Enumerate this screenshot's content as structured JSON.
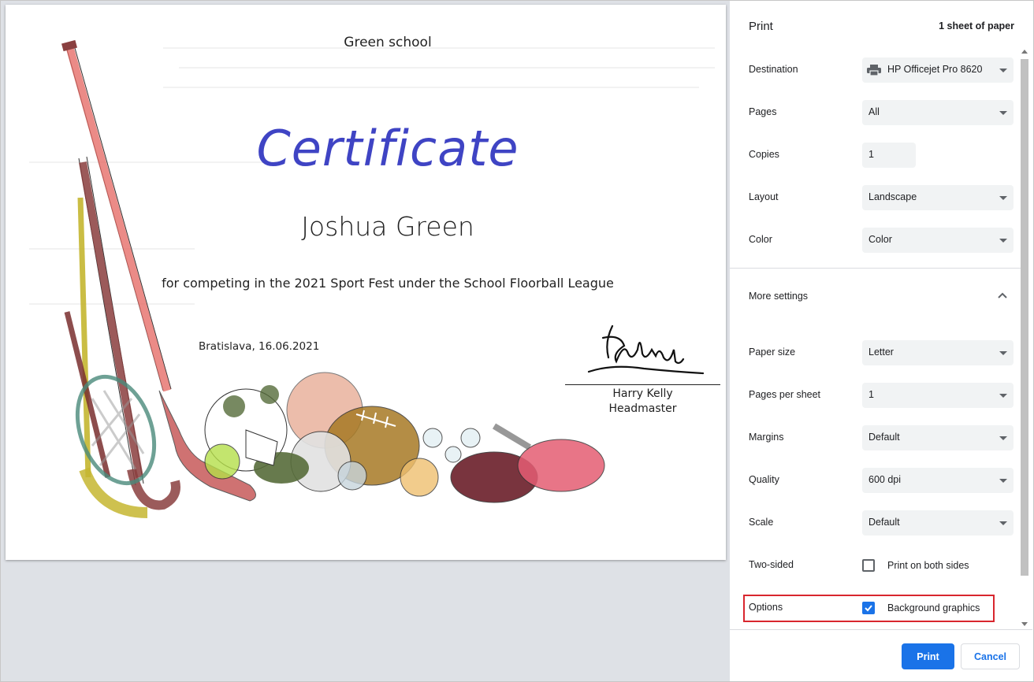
{
  "certificate": {
    "school": "Green school",
    "title": "Certificate",
    "name": "Joshua Green",
    "reason": "for competing in the 2021 Sport Fest under the School Floorball League",
    "place_date": "Bratislava, 16.06.2021",
    "signer_name": "Harry Kelly",
    "signer_role": "Headmaster"
  },
  "print": {
    "title": "Print",
    "sheets": "1 sheet of paper",
    "destination": {
      "label": "Destination",
      "value": "HP Officejet Pro 8620",
      "icon": "printer-icon"
    },
    "pages": {
      "label": "Pages",
      "value": "All"
    },
    "copies": {
      "label": "Copies",
      "value": "1"
    },
    "layout": {
      "label": "Layout",
      "value": "Landscape"
    },
    "color": {
      "label": "Color",
      "value": "Color"
    },
    "more_settings": {
      "label": "More settings",
      "icon": "chevron-up-icon"
    },
    "paper_size": {
      "label": "Paper size",
      "value": "Letter"
    },
    "pages_per_sheet": {
      "label": "Pages per sheet",
      "value": "1"
    },
    "margins": {
      "label": "Margins",
      "value": "Default"
    },
    "quality": {
      "label": "Quality",
      "value": "600 dpi"
    },
    "scale": {
      "label": "Scale",
      "value": "Default"
    },
    "two_sided": {
      "label": "Two-sided",
      "checkbox_label": "Print on both sides",
      "checked": false
    },
    "options": {
      "label": "Options",
      "checkbox_label": "Background graphics",
      "checked": true
    },
    "print_button": "Print",
    "cancel_button": "Cancel"
  },
  "colors": {
    "accent": "#1a73e8",
    "title_blue": "#3f44c4",
    "highlight": "#d8262e",
    "preview_bg": "#dee1e6"
  }
}
